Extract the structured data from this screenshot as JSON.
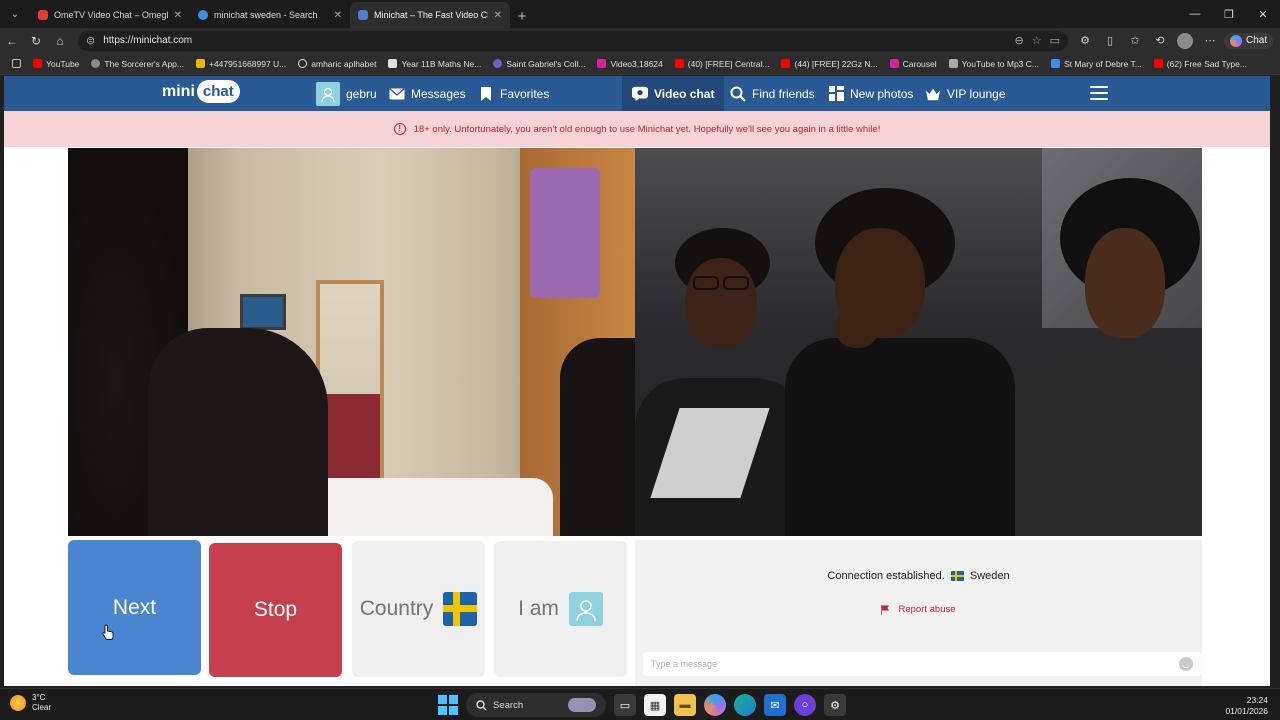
{
  "browser": {
    "tabs": [
      {
        "title": "OmeTV Video Chat – Omegl",
        "color": "#e33b2e",
        "active": false
      },
      {
        "title": "minichat sweden - Search",
        "color": "#3a8ee6",
        "active": false
      },
      {
        "title": "Minichat – The Fast Video Ch",
        "color": "#4a7fd1",
        "active": true
      }
    ],
    "url": "https://minichat.com",
    "copilot_label": "Chat",
    "bookmarks": [
      {
        "label": "YouTube",
        "color": "#ff0000"
      },
      {
        "label": "The Sorcerer's App...",
        "color": "#8a8a8a"
      },
      {
        "label": "+447951668997 U...",
        "color": "#f2b705"
      },
      {
        "label": "amharic aplhabet",
        "color": "#dddddd"
      },
      {
        "label": "Year 11B Maths Ne...",
        "color": "#e0e0e0"
      },
      {
        "label": "Saint Gabriel's Coll...",
        "color": "#7a5cc7"
      },
      {
        "label": "Video3,18624",
        "color": "#d6249f"
      },
      {
        "label": "(40) [FREE] Central...",
        "color": "#ff0000"
      },
      {
        "label": "(44) [FREE] 22Gz N...",
        "color": "#ff0000"
      },
      {
        "label": "Carousel",
        "color": "#d6249f"
      },
      {
        "label": "YouTube to Mp3 C...",
        "color": "#aaaaaa"
      },
      {
        "label": "St Mary of Debre T...",
        "color": "#3a8ee6"
      },
      {
        "label": "(62) Free Sad Type...",
        "color": "#ff0000"
      }
    ]
  },
  "site": {
    "logo": {
      "mini": "mini",
      "chat": "chat"
    },
    "nav": {
      "user": "gebru",
      "messages": "Messages",
      "favorites": "Favorites",
      "video_chat": "Video chat",
      "find_friends": "Find friends",
      "new_photos": "New photos",
      "vip_lounge": "VIP lounge"
    },
    "alert": "18+ only. Unfortunately, you aren't old enough to use Minichat yet. Hopefully we'll see you again in a little while!",
    "alert_icon_glyph": "!",
    "controls": {
      "next": "Next",
      "stop": "Stop",
      "country": "Country",
      "i_am": "I am"
    },
    "status": {
      "text": "Connection established.",
      "country": "Sweden"
    },
    "report": "Report abuse",
    "message_placeholder": "Type a message",
    "colors": {
      "nav_bg": "#2a5a94",
      "next_btn": "#4a86cf",
      "stop_btn": "#c5404c",
      "alert_bg": "#f5d3d6",
      "alert_text": "#c0262d"
    }
  },
  "taskbar": {
    "weather_temp": "3°C",
    "weather_desc": "Clear",
    "search_placeholder": "Search",
    "time": "23:24",
    "date": "01/01/2026"
  }
}
